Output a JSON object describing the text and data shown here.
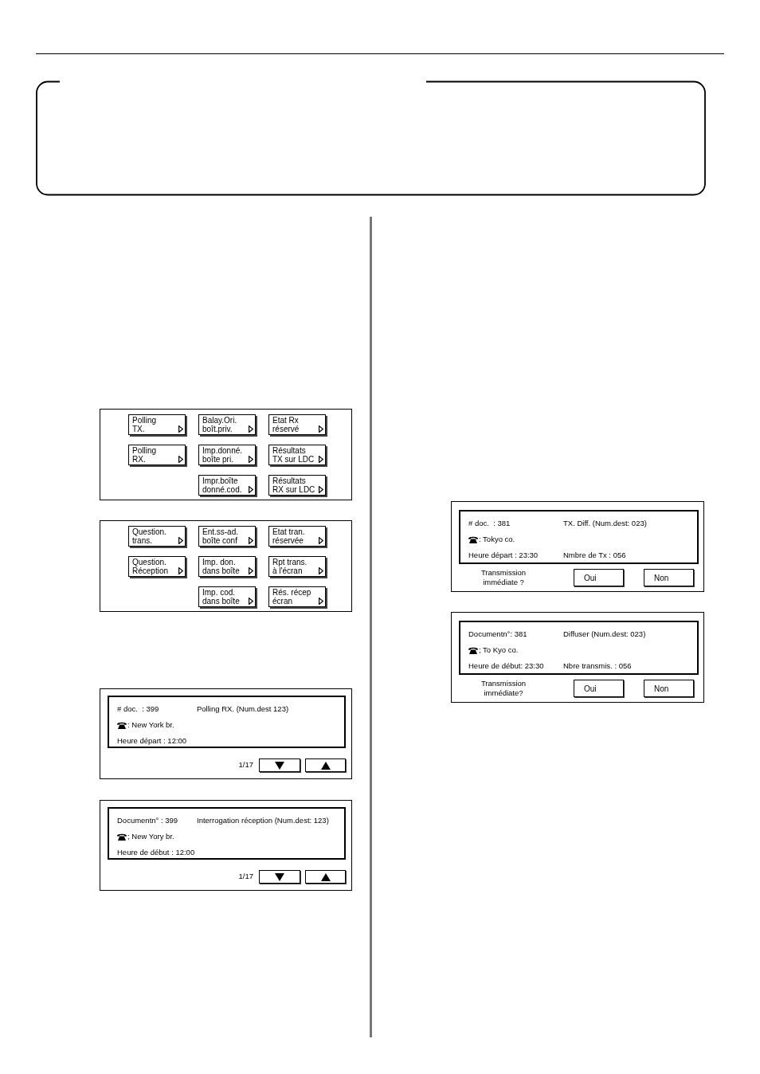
{
  "left_column": {
    "menu_screens": [
      {
        "rows": [
          [
            "Polling\nTX.",
            "Balay.Ori.\nboît.priv.",
            "Etat Rx\nréservé"
          ],
          [
            "Polling\nRX.",
            "Imp.donné.\nboîte pri.",
            "Résultats\nTX sur LDC"
          ],
          [
            "",
            "Impr.boîte\ndonné.cod.",
            "Résultats\nRX sur LDC"
          ]
        ]
      },
      {
        "rows": [
          [
            "Question.\ntrans.",
            "Ent.ss-ad.\nboîte conf",
            "Etat tran.\nréservée"
          ],
          [
            "Question.\nRéception",
            "Imp. don.\ndans boîte",
            "Rpt trans.\nà l'écran"
          ],
          [
            "",
            "Imp. cod.\ndans boîte",
            "Rés. récep\nécran"
          ]
        ]
      }
    ],
    "status_screens": [
      {
        "kind": "paged",
        "document": "# doc.  : 399",
        "mode": "Polling RX. (Num.dest 123)",
        "destination": ": New York br.",
        "start_time": "Heure départ : 12:00",
        "page": "1/17"
      },
      {
        "kind": "paged",
        "document": "Documentn° : 399",
        "mode": "Interrogation réception (Num.dest: 123)",
        "destination": "; New Yory br.",
        "start_time": "Heure de début : 12:00",
        "page": "1/17"
      }
    ]
  },
  "right_column": {
    "status_screens": [
      {
        "kind": "confirm",
        "document": "# doc.  : 381",
        "mode": "TX. Diff. (Num.dest: 023)",
        "destination": ": Tokyo co.",
        "start_time": "Heure départ : 23:30",
        "count": "Nmbre de Tx : 056",
        "prompt": "Transmission\nimmédiate ?",
        "buttons": [
          "Oui",
          "Non"
        ]
      },
      {
        "kind": "confirm",
        "document": "Documentn°: 381",
        "mode": "Diffuser (Num.dest: 023)",
        "destination": "; To Kyo co.",
        "start_time": "Heure de début: 23:30",
        "count": "Nbre transmis. : 056",
        "prompt": "Transmission\nimmédiate?",
        "buttons": [
          "Oui",
          "Non"
        ]
      }
    ]
  }
}
